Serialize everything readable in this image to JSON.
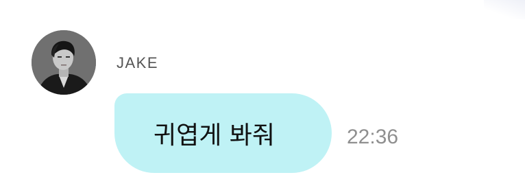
{
  "conversation": {
    "message": {
      "sender": "JAKE",
      "text": "귀엽게 봐줘",
      "time": "22:36"
    }
  },
  "colors": {
    "bubble": "#bff2f5",
    "sender_name": "#555555",
    "timestamp": "#8f8f8f"
  }
}
